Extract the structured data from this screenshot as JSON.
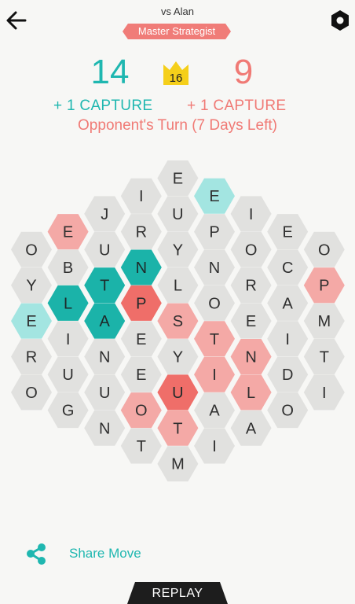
{
  "header": {
    "opponent": "vs Alan",
    "rank": "Master Strategist",
    "player_score": "14",
    "opponent_score": "9",
    "crown_value": "16",
    "player_capture": "+ 1 CAPTURE",
    "opponent_capture": "+ 1 CAPTURE",
    "turn_status": "Opponent's Turn (7 Days Left)"
  },
  "colors": {
    "teal": "#1fb7b0",
    "teal_dark": "#1bb3a9",
    "teal_light": "#a3e5e1",
    "red_dark": "#ef6e69",
    "red_light": "#f4a9a6",
    "neutral": "#e1e1df",
    "gold": "#f5cf1a"
  },
  "board": {
    "columns": [
      {
        "cells": [
          [
            "O",
            "neutral"
          ],
          [
            "Y",
            "neutral"
          ],
          [
            "E",
            "teal_light"
          ],
          [
            "R",
            "neutral"
          ],
          [
            "O",
            "neutral"
          ]
        ]
      },
      {
        "cells": [
          [
            "E",
            "red_light"
          ],
          [
            "B",
            "neutral"
          ],
          [
            "L",
            "teal_dark"
          ],
          [
            "I",
            "neutral"
          ],
          [
            "U",
            "neutral"
          ],
          [
            "G",
            "neutral"
          ]
        ]
      },
      {
        "cells": [
          [
            "J",
            "neutral"
          ],
          [
            "U",
            "neutral"
          ],
          [
            "T",
            "teal_dark"
          ],
          [
            "A",
            "teal_dark"
          ],
          [
            "N",
            "neutral"
          ],
          [
            "U",
            "neutral"
          ],
          [
            "N",
            "neutral"
          ]
        ]
      },
      {
        "cells": [
          [
            "I",
            "neutral"
          ],
          [
            "R",
            "neutral"
          ],
          [
            "N",
            "teal_dark"
          ],
          [
            "P",
            "red_dark"
          ],
          [
            "E",
            "neutral"
          ],
          [
            "E",
            "neutral"
          ],
          [
            "O",
            "red_light"
          ],
          [
            "T",
            "neutral"
          ]
        ]
      },
      {
        "cells": [
          [
            "E",
            "neutral"
          ],
          [
            "U",
            "neutral"
          ],
          [
            "Y",
            "neutral"
          ],
          [
            "L",
            "neutral"
          ],
          [
            "S",
            "red_light"
          ],
          [
            "Y",
            "neutral"
          ],
          [
            "U",
            "red_dark"
          ],
          [
            "T",
            "red_light"
          ],
          [
            "M",
            "neutral"
          ]
        ]
      },
      {
        "cells": [
          [
            "E",
            "teal_light"
          ],
          [
            "P",
            "neutral"
          ],
          [
            "N",
            "neutral"
          ],
          [
            "O",
            "neutral"
          ],
          [
            "T",
            "red_light"
          ],
          [
            "I",
            "red_light"
          ],
          [
            "A",
            "neutral"
          ],
          [
            "I",
            "neutral"
          ]
        ]
      },
      {
        "cells": [
          [
            "I",
            "neutral"
          ],
          [
            "O",
            "neutral"
          ],
          [
            "R",
            "neutral"
          ],
          [
            "E",
            "neutral"
          ],
          [
            "N",
            "red_light"
          ],
          [
            "L",
            "red_light"
          ],
          [
            "A",
            "neutral"
          ]
        ]
      },
      {
        "cells": [
          [
            "E",
            "neutral"
          ],
          [
            "C",
            "neutral"
          ],
          [
            "A",
            "neutral"
          ],
          [
            "I",
            "neutral"
          ],
          [
            "D",
            "neutral"
          ],
          [
            "O",
            "neutral"
          ]
        ]
      },
      {
        "cells": [
          [
            "O",
            "neutral"
          ],
          [
            "P",
            "red_light"
          ],
          [
            "M",
            "neutral"
          ],
          [
            "T",
            "neutral"
          ],
          [
            "I",
            "neutral"
          ]
        ]
      }
    ]
  },
  "footer": {
    "share_label": "Share Move",
    "share_icon": "share-icon",
    "replay_label": "REPLAY"
  }
}
